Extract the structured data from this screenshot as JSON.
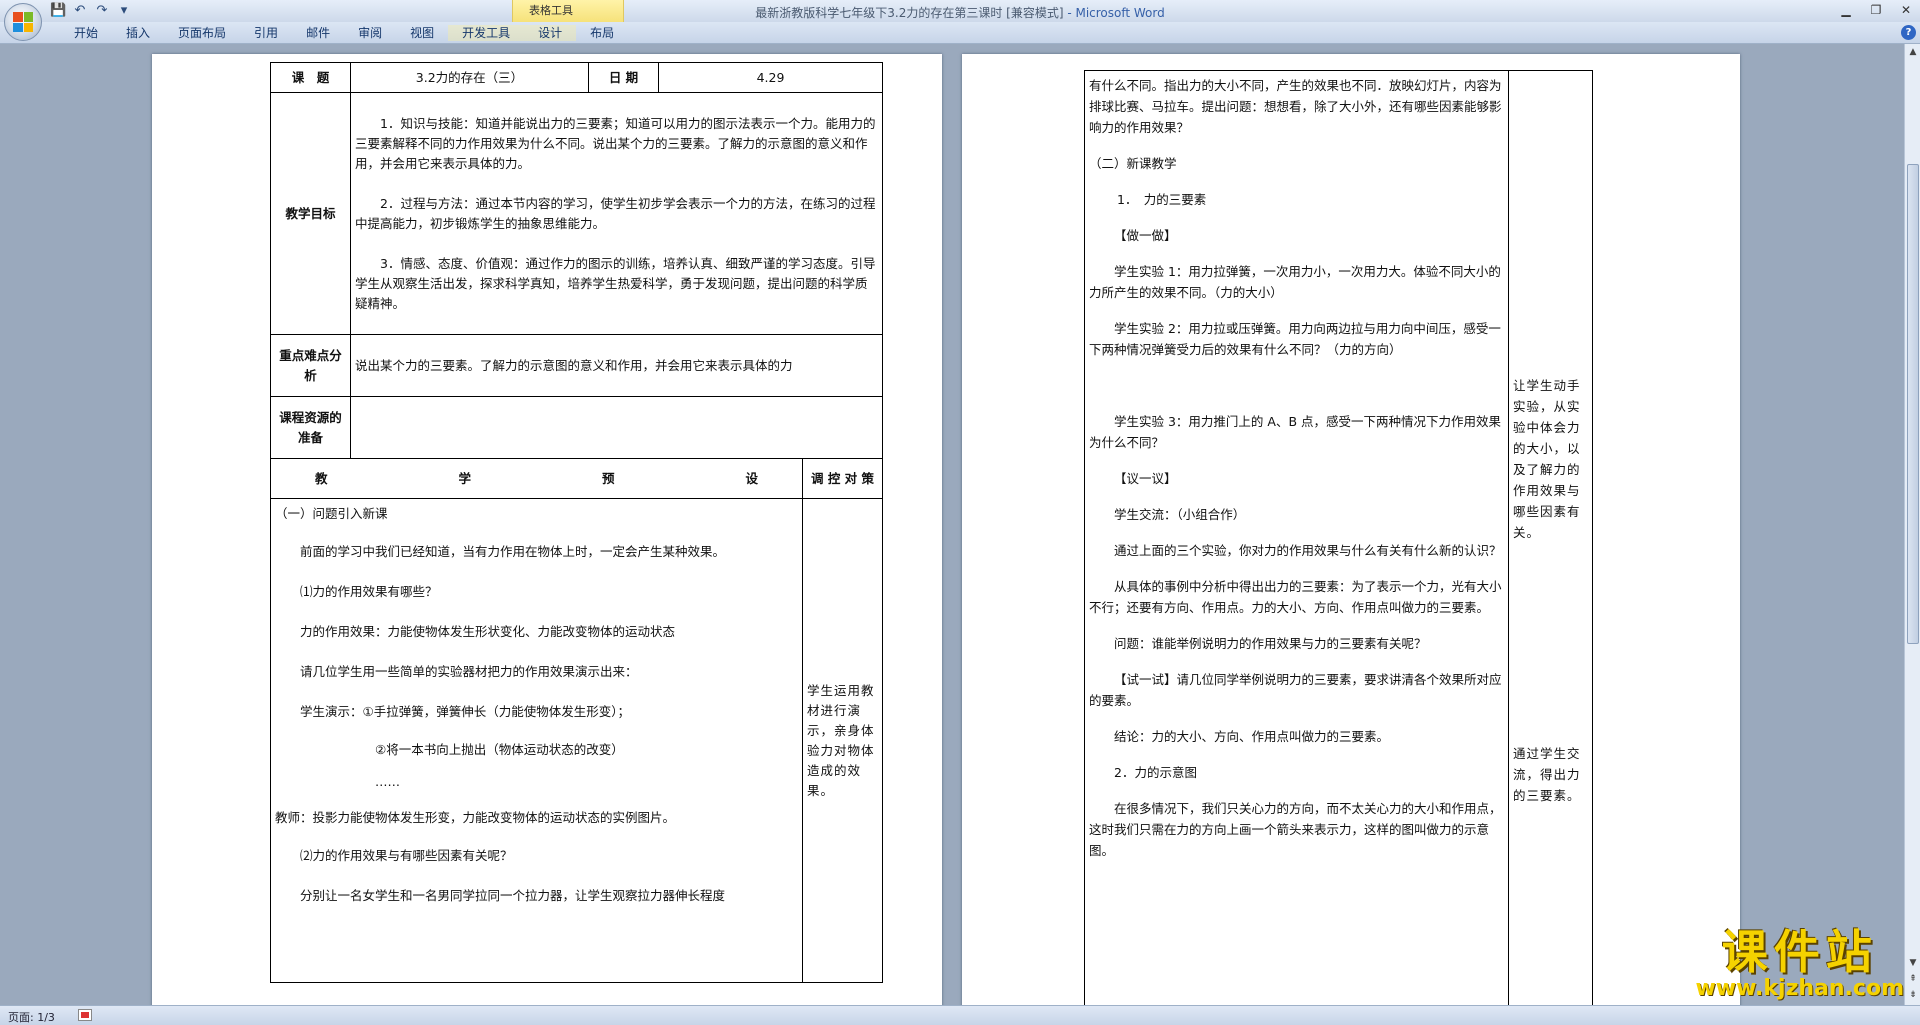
{
  "window": {
    "title": "最新浙教版科学七年级下3.2力的存在第三课时 [兼容模式]",
    "brand": " - Microsoft Word",
    "context_tab": "表格工具"
  },
  "ribbon": {
    "tabs": [
      "开始",
      "插入",
      "页面布局",
      "引用",
      "邮件",
      "审阅",
      "视图",
      "开发工具",
      "设计",
      "布局"
    ]
  },
  "status": {
    "page": "页面: 1/3"
  },
  "page1": {
    "course_label": "课　题",
    "course_title": "3.2力的存在（三）",
    "date_label": "日 期",
    "date": "4.29",
    "goals_label": "教学目标",
    "goals": [
      "1．知识与技能：知道并能说出力的三要素；知道可以用力的图示法表示一个力。能用力的三要素解释不同的力作用效果为什么不同。说出某个力的三要素。了解力的示意图的意义和作用，并会用它来表示具体的力。",
      "2．过程与方法：通过本节内容的学习，使学生初步学会表示一个力的方法，在练习的过程中提高能力，初步锻炼学生的抽象思维能力。",
      "3．情感、态度、价值观：通过作力的图示的训练，培养认真、细致严谨的学习态度。引导学生从观察生活出发，探求科学真知，培养学生热爱科学，勇于发现问题，提出问题的科学质疑精神。"
    ],
    "key_label": "重点难点分析",
    "key_text": "说出某个力的三要素。了解力的示意图的意义和作用，并会用它来表示具体的力",
    "resource_label": "课程资源的准备",
    "design_header": [
      "教",
      "学",
      "预",
      "设"
    ],
    "control_header": "调 控 对 策",
    "lesson_lines": [
      "（一）问题引入新课",
      "前面的学习中我们已经知道，当有力作用在物体上时，一定会产生某种效果。",
      "⑴力的作用效果有哪些？",
      "力的作用效果：力能使物体发生形状变化、力能改变物体的运动状态",
      "请几位学生用一些简单的实验器材把力的作用效果演示出来：",
      "学生演示：①手拉弹簧，弹簧伸长（力能使物体发生形变）；",
      "②将一本书向上抛出（物体运动状态的改变）",
      "……",
      "教师：投影力能使物体发生形变，力能改变物体的运动状态的实例图片。",
      "⑵力的作用效果与有哪些因素有关呢？",
      "分别让一名女学生和一名男同学拉同一个拉力器，让学生观察拉力器伸长程度"
    ],
    "control_text": "学生运用教材进行演示，亲身体验力对物体造成的效果。"
  },
  "page2": {
    "lines": [
      "有什么不同。指出力的大小不同，产生的效果也不同．放映幻灯片，内容为排球比赛、马拉车。提出问题：想想看，除了大小外，还有哪些因素能够影响力的作用效果？",
      "（二）新课教学",
      "1．　力的三要素",
      "【做一做】",
      "学生实验 1：用力拉弹簧，一次用力小，一次用力大。体验不同大小的力所产生的效果不同。（力的大小）",
      "学生实验 2：用力拉或压弹簧。用力向两边拉与用力向中间压，感受一下两种情况弹簧受力后的效果有什么不同？（力的方向）",
      "",
      "学生实验 3：用力推门上的 A、B 点，感受一下两种情况下力作用效果为什么不同？",
      "【议一议】",
      "学生交流：（小组合作）",
      "通过上面的三个实验，你对力的作用效果与什么有关有什么新的认识？",
      "从具体的事例中分析中得出出力的三要素：为了表示一个力，光有大小不行；还要有方向、作用点。力的大小、方向、作用点叫做力的三要素。",
      "问题：谁能举例说明力的作用效果与力的三要素有关呢？",
      "【试一试】请几位同学举例说明力的三要素，要求讲清各个效果所对应的要素。",
      "结论：力的大小、方向、作用点叫做力的三要素。",
      "2．力的示意图",
      "在很多情况下，我们只关心力的方向，而不太关心力的大小和作用点，这时我们只需在力的方向上画一个箭头来表示力，这样的图叫做力的示意图。"
    ],
    "control_1": "让学生动手实验，从实验中体会力的大小，以及了解力的作用效果与哪些因素有关。",
    "control_2": "通过学生交流，得出力的三要素。"
  },
  "watermark": {
    "cn": "课件站",
    "url": "www.kjzhan.com"
  }
}
